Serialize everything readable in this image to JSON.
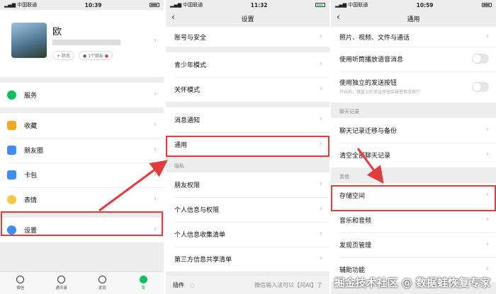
{
  "status": {
    "p1": {
      "carrier": "中国联通",
      "time": "10:39"
    },
    "p2": {
      "carrier": "中国联通",
      "time": "11:32"
    },
    "p3": {
      "carrier": "中国联通",
      "time": "10:59"
    }
  },
  "profile": {
    "name": "欧",
    "status_label": "+ 状态",
    "friends_label": "1个朋友"
  },
  "me_menu": {
    "service": "服务",
    "favorites": "收藏",
    "moments": "朋友圈",
    "cards": "卡包",
    "stickers": "表情",
    "settings": "设置"
  },
  "tabs": [
    {
      "label": "微信"
    },
    {
      "label": "通讯录"
    },
    {
      "label": "发现"
    },
    {
      "label": "我"
    }
  ],
  "settings_page": {
    "title": "设置",
    "items": {
      "account": "账号与安全",
      "teen": "青少年模式",
      "care": "关怀模式",
      "notify": "消息通知",
      "general": "通用",
      "privacy_section": "隐私",
      "friend_perm": "朋友权限",
      "personal_info": "个人信息与权限",
      "info_list": "个人信息收集清单",
      "third_party": "第三方信息共享清单",
      "plugin": "插件"
    },
    "input_hint": "微信输入法可以【问AI】了"
  },
  "general_page": {
    "title": "通用",
    "items": {
      "media": "照片、视频、文件与通话",
      "earpiece": "使用听筒播放语音消息",
      "send_btn": "使用独立的发送按钮",
      "send_btn_sub": "开启后，键盘上的发送按钮会被替换成换行",
      "chat_section": "聊天记录",
      "migrate": "聊天记录迁移与备份",
      "clear": "清空全部聊天记录",
      "other_section": "其他",
      "storage": "存储空间",
      "music": "音乐和音频",
      "discover": "发现页管理",
      "assist": "辅助功能"
    }
  },
  "watermark": "掘金技术社区 @ 数据蛙恢复专家",
  "colors": {
    "highlight": "#e23b3b",
    "accent": "#07c160"
  }
}
